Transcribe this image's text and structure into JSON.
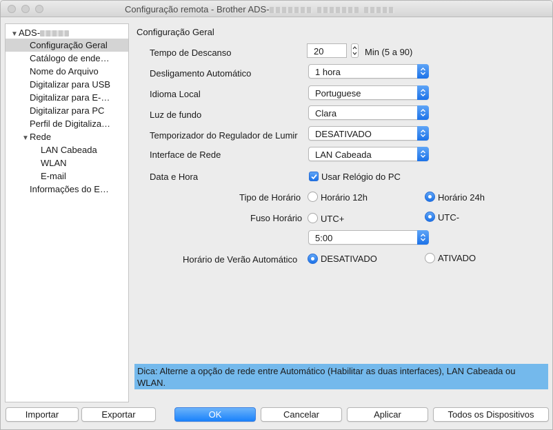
{
  "window": {
    "title": "Configuração remota - Brother ADS-"
  },
  "sidebar": {
    "root": "ADS-",
    "items": [
      {
        "label": "Configuração Geral"
      },
      {
        "label": "Catálogo de ende…"
      },
      {
        "label": "Nome do Arquivo"
      },
      {
        "label": "Digitalizar para USB"
      },
      {
        "label": "Digitalizar para E-…"
      },
      {
        "label": "Digitalizar para PC"
      },
      {
        "label": "Perfil de Digitaliza…"
      },
      {
        "label": "Rede"
      },
      {
        "label": "LAN Cabeada"
      },
      {
        "label": "WLAN"
      },
      {
        "label": "E-mail"
      },
      {
        "label": "Informações do E…"
      }
    ]
  },
  "main": {
    "section_title": "Configuração Geral",
    "sleep": {
      "label": "Tempo de Descanso",
      "value": "20",
      "unit": "Min (5 a 90)"
    },
    "auto_off": {
      "label": "Desligamento Automático",
      "value": "1 hora"
    },
    "language": {
      "label": "Idioma Local",
      "value": "Portuguese"
    },
    "backlight": {
      "label": "Luz de fundo",
      "value": "Clara"
    },
    "dimmer": {
      "label": "Temporizador do Regulador de Lumir",
      "value": "DESATIVADO"
    },
    "network_if": {
      "label": "Interface de Rede",
      "value": "LAN Cabeada"
    },
    "datetime": {
      "label": "Data e Hora",
      "use_pc_clock": "Usar Relógio do PC",
      "use_pc_clock_checked": true
    },
    "time_type": {
      "label": "Tipo de Horário",
      "opt_12h": "Horário 12h",
      "opt_24h": "Horário 24h",
      "selected": "24h"
    },
    "timezone": {
      "label": "Fuso Horário",
      "opt_plus": "UTC+",
      "opt_minus": "UTC-",
      "selected": "minus",
      "offset": "5:00"
    },
    "dst": {
      "label": "Horário de Verão Automático",
      "opt_off": "DESATIVADO",
      "opt_on": "ATIVADO",
      "selected": "off"
    },
    "tip": "Dica: Alterne a opção de rede entre Automático (Habilitar as duas interfaces), LAN Cabeada ou WLAN."
  },
  "buttons": {
    "import": "Importar",
    "export": "Exportar",
    "ok": "OK",
    "cancel": "Cancelar",
    "apply": "Aplicar",
    "all_devices": "Todos os Dispositivos"
  },
  "colors": {
    "accent": "#1c72e8",
    "tip_bg": "#74b9ec",
    "selection": "#d4d4d4"
  }
}
